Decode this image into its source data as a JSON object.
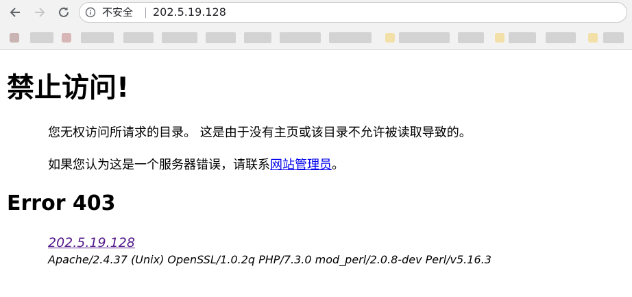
{
  "browser": {
    "security_label": "不安全",
    "url": "202.5.19.128",
    "icons": {
      "back": "back-arrow-icon",
      "forward": "forward-arrow-icon",
      "reload": "reload-icon",
      "site_info": "info-circle-icon"
    }
  },
  "page": {
    "title": "禁止访问!",
    "message_line1": "您无权访问所请求的目录。 这是由于没有主页或该目录不允许被读取导致的。",
    "message_line2_prefix": "如果您认为这是一个服务器错误，请联系",
    "admin_link_label": "网站管理员",
    "message_line2_suffix": "。",
    "error_heading": "Error 403",
    "host_link_label": "202.5.19.128",
    "server_signature": "Apache/2.4.37 (Unix) OpenSSL/1.0.2q PHP/7.3.0 mod_perl/2.0.8-dev Perl/v5.16.3"
  },
  "colors": {
    "link": "#0000ee",
    "visited_link": "#551a8b",
    "chrome_bg": "#f2f2f2"
  }
}
